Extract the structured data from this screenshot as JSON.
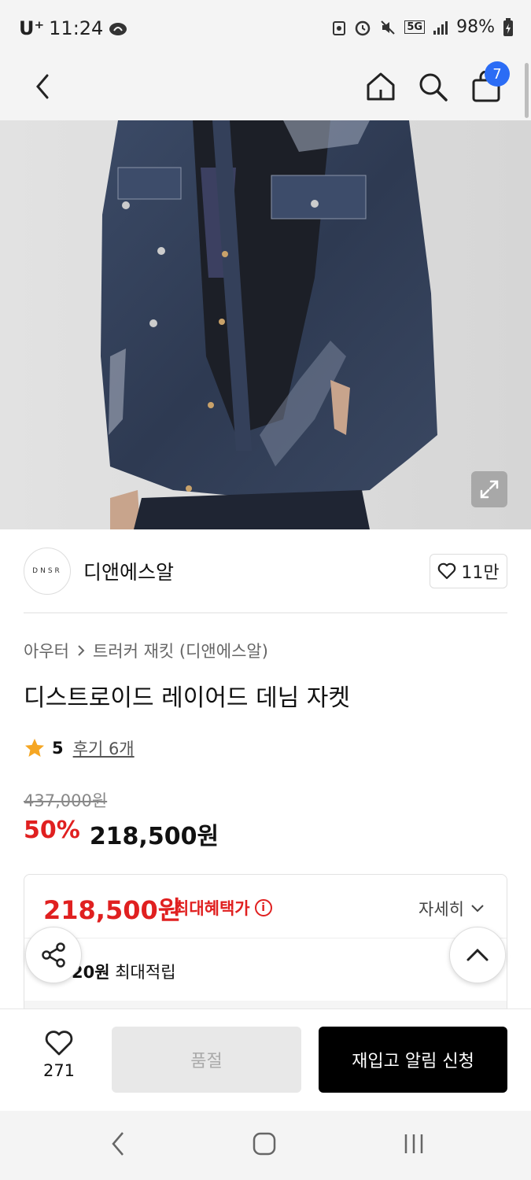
{
  "status_bar": {
    "carrier": "U⁺",
    "time": "11:24",
    "network": "5G",
    "battery": "98%"
  },
  "top_nav": {
    "cart_count": "7"
  },
  "brand": {
    "logo_text": "DNSR",
    "name": "디앤에스알",
    "likes": "11만"
  },
  "product": {
    "breadcrumb": [
      "아우터",
      "트러커 재킷 (디앤에스알)"
    ],
    "title": "디스트로이드 레이어드 데님 자켓",
    "rating": "5",
    "review_link": "후기 6개",
    "original_price": "437,000원",
    "discount": "50%",
    "price": "218,500원"
  },
  "benefit": {
    "max_price": "218,500원",
    "max_label": "최대혜택가",
    "detail": "자세히",
    "points_amount": "20원",
    "points_label": "최대적립"
  },
  "action_bar": {
    "wish_count": "271",
    "soldout_label": "품절",
    "restock_label": "재입고 알림 신청"
  },
  "colors": {
    "accent_red": "#e02020",
    "badge_blue": "#2b6cf5",
    "star": "#f5a623"
  }
}
